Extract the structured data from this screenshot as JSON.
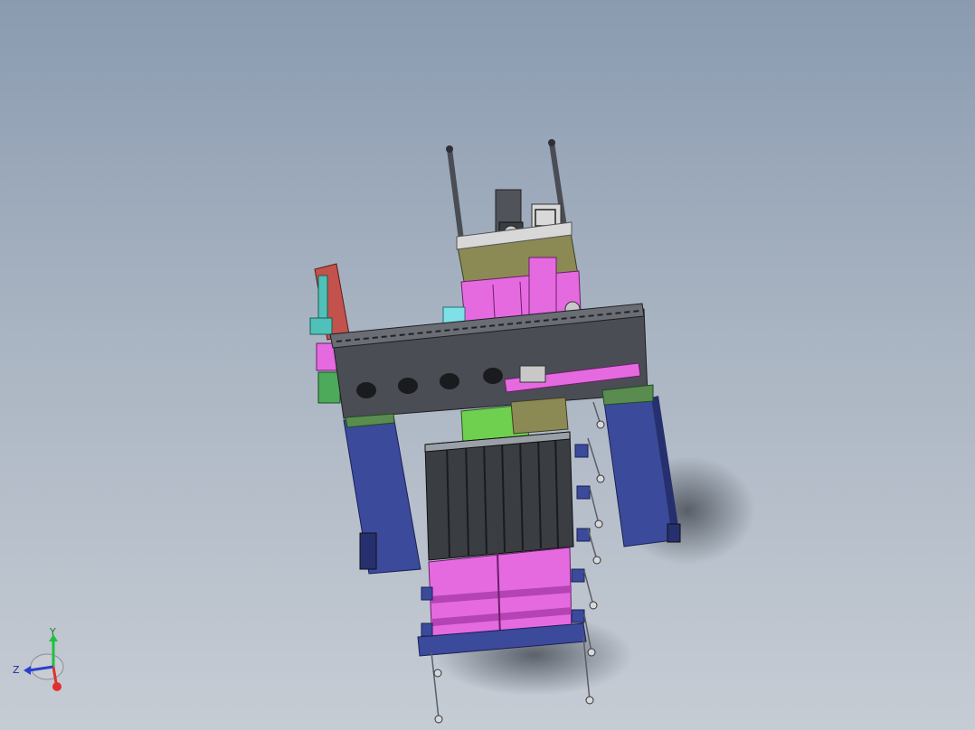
{
  "viewport": {
    "background_top": "#8a9bb0",
    "background_bottom": "#c6ccd4"
  },
  "model": {
    "colors": {
      "frame_blue": "#3b4a9a",
      "frame_blue_dark": "#26306e",
      "beam_dark": "#4a4d54",
      "beam_top": "#5a5e66",
      "magenta": "#e56ae0",
      "magenta_dark": "#b443b3",
      "olive": "#8b8a55",
      "green_plate": "#6fcf4f",
      "teal": "#4fc1b8",
      "red_block": "#c2524b",
      "black_tray": "#3a3d42",
      "steel": "#9aa0a8"
    }
  },
  "triad": {
    "x_label": "",
    "y_label": "Y",
    "z_label": "Z",
    "x_color": "#e03030",
    "y_color": "#20c040",
    "z_color": "#2a3fd0"
  }
}
